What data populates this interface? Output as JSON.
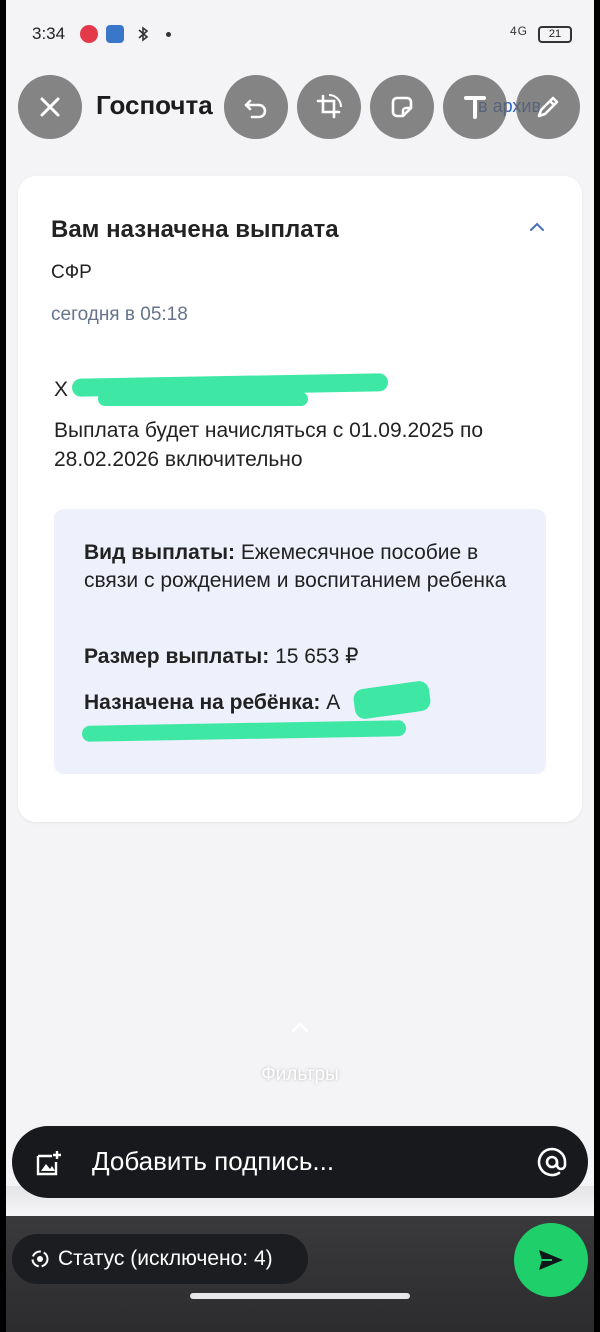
{
  "status_bar": {
    "time": "3:34",
    "network": "4G",
    "battery": "21"
  },
  "header": {
    "title": "Госпочта",
    "archive_link": "в архив"
  },
  "message": {
    "title": "Вам назначена выплата",
    "sender": "СФР",
    "date": "сегодня в 05:18",
    "recipient_visible": "Х",
    "body": "Выплата будет начисляться с 01.09.2025 по 28.02.2026 включительно",
    "details": {
      "type_label": "Вид выплаты:",
      "type_value": "Ежемесячное пособие в связи с рождением и воспитанием ребенка",
      "amount_label": "Размер выплаты:",
      "amount_value": "15 653 ₽",
      "child_label": "Назначена на ребёнка:",
      "child_value": "А"
    }
  },
  "filters": {
    "label": "Фильтры"
  },
  "composer": {
    "caption_placeholder": "Добавить подпись...",
    "status_label": "Статус (исключено: 4)"
  },
  "icons": {
    "close": "close-icon",
    "undo": "undo-icon",
    "crop": "crop-rotate-icon",
    "sticker": "sticker-icon",
    "text": "text-icon",
    "draw": "pencil-icon",
    "send": "send-icon"
  },
  "colors": {
    "accent_link": "#3063c9",
    "info_box": "#eef0fb",
    "send_button": "#1fcf6a",
    "redaction": "#3fe7a5"
  }
}
